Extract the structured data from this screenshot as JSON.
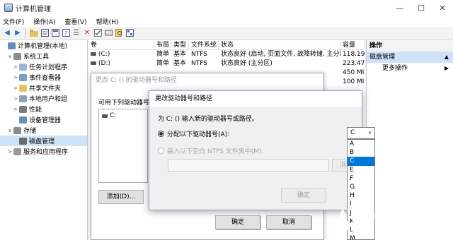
{
  "window": {
    "title": "计算机管理",
    "controls": [
      "—",
      "☐",
      "✕"
    ]
  },
  "menu": [
    "文件(F)",
    "操作(A)",
    "查看(V)",
    "帮助(H)"
  ],
  "toolbar": {
    "icons": [
      "back-icon",
      "forward-icon",
      "folder-icon",
      "list-icon",
      "properties-icon",
      "help-icon",
      "connect-icon",
      "delete-icon",
      "check-icon",
      "disk-icon",
      "search-icon",
      "export-icon"
    ]
  },
  "tree": [
    {
      "label": "计算机管理(本地)",
      "indent": 0,
      "twisty": "",
      "icon": "computer-icon",
      "color": "#6a8bb7"
    },
    {
      "label": "系统工具",
      "indent": 1,
      "twisty": "∨",
      "icon": "tools-icon",
      "color": "#8c8c8c"
    },
    {
      "label": "任务计划程序",
      "indent": 2,
      "twisty": ">",
      "icon": "task-scheduler-icon",
      "color": "#9bb7d6"
    },
    {
      "label": "事件查看器",
      "indent": 2,
      "twisty": ">",
      "icon": "event-viewer-icon",
      "color": "#7aa0c4"
    },
    {
      "label": "共享文件夹",
      "indent": 2,
      "twisty": ">",
      "icon": "shared-folder-icon",
      "color": "#e8c15a"
    },
    {
      "label": "本地用户和组",
      "indent": 2,
      "twisty": ">",
      "icon": "users-icon",
      "color": "#8aa0b8"
    },
    {
      "label": "性能",
      "indent": 2,
      "twisty": ">",
      "icon": "performance-icon",
      "color": "#7c7c7c"
    },
    {
      "label": "设备管理器",
      "indent": 2,
      "twisty": "",
      "icon": "device-manager-icon",
      "color": "#6f8fb0"
    },
    {
      "label": "存储",
      "indent": 1,
      "twisty": "∨",
      "icon": "storage-icon",
      "color": "#8c8c8c"
    },
    {
      "label": "磁盘管理",
      "indent": 2,
      "twisty": "",
      "icon": "disk-management-icon",
      "color": "#6b6b6b",
      "selected": true
    },
    {
      "label": "服务和应用程序",
      "indent": 1,
      "twisty": ">",
      "icon": "services-icon",
      "color": "#9a9a9a"
    }
  ],
  "volumes": {
    "headers": [
      "卷",
      "布局",
      "类型",
      "文件系统",
      "状态",
      "容量"
    ],
    "rows": [
      [
        "(C:)",
        "简单",
        "基本",
        "NTFS",
        "状态良好 (启动, 页面文件, 故障转储, 主分区)",
        "118.19"
      ],
      [
        "(D:)",
        "简单",
        "基本",
        "NTFS",
        "状态良好 (主分区)",
        "223.47"
      ],
      [
        "",
        "",
        "",
        "",
        "",
        "450 MI"
      ],
      [
        "",
        "",
        "",
        "",
        "",
        "100 MI"
      ]
    ]
  },
  "actions": {
    "header": "操作",
    "section": "磁盘管理",
    "item": "更多操作"
  },
  "dialog_bg": {
    "title": "更改 C: () 的驱动器号和路径",
    "label": "可用下列驱动器号和",
    "list_item": "C:",
    "add": "添加(D)...",
    "ok": "确定",
    "cancel": "取消"
  },
  "dialog_fg": {
    "title": "更改驱动器号和路径",
    "prompt": "为 C: () 输入新的驱动器号或路径。",
    "option_letter": "分配以下驱动器号(A):",
    "option_folder": "装入以下空白 NTFS 文件夹中(M):",
    "browse": "浏",
    "ok_inner": "确定",
    "ok": "确定",
    "cancel": "取消"
  },
  "drive_select": {
    "value": "C",
    "options": [
      "A",
      "B",
      "C",
      "E",
      "F",
      "G",
      "H",
      "I",
      "J",
      "K",
      "L",
      "M"
    ],
    "selected": "C"
  },
  "colors": {
    "accent": "#0078d7",
    "selection": "#cce4f7",
    "action_highlight": "#cfe2f7"
  }
}
